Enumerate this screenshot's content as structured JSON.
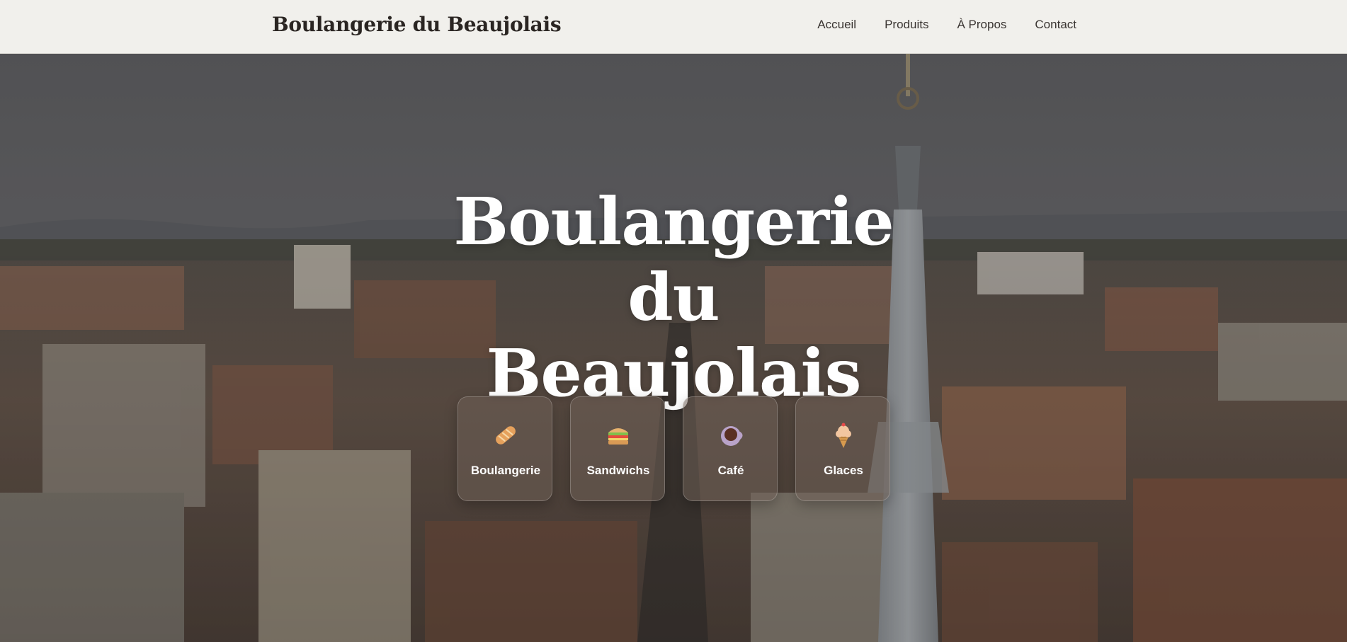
{
  "header": {
    "brand": "Boulangerie du Beaujolais",
    "nav": [
      "Accueil",
      "Produits",
      "À Propos",
      "Contact"
    ]
  },
  "hero": {
    "title_lines": [
      "Boulangerie",
      "du",
      "Beaujolais"
    ],
    "background": "aerial-city-with-church-spire",
    "categories": [
      {
        "label": "Boulangerie",
        "icon": "bread-icon"
      },
      {
        "label": "Sandwichs",
        "icon": "sandwich-icon"
      },
      {
        "label": "Café",
        "icon": "coffee-icon"
      },
      {
        "label": "Glaces",
        "icon": "ice-cream-icon"
      }
    ]
  },
  "colors": {
    "header_bg": "#f1f0ec",
    "brand_text": "#2a2522",
    "hero_text": "#ffffff"
  }
}
